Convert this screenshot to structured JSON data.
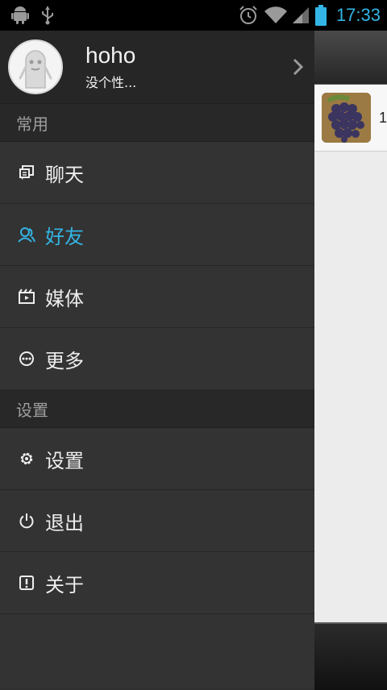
{
  "status_bar": {
    "time": "17:33",
    "icons": [
      "android-icon",
      "usb-icon",
      "alarm-icon",
      "wifi-icon",
      "signal-icon",
      "battery-icon"
    ]
  },
  "profile": {
    "username": "hoho",
    "signature": "没个性..."
  },
  "sections": {
    "common": "常用",
    "settings": "设置"
  },
  "menu": {
    "chat": "聊天",
    "friends": "好友",
    "media": "媒体",
    "more": "更多",
    "settings": "设置",
    "logout": "退出",
    "about": "关于"
  },
  "content": {
    "row_text": "1"
  },
  "colors": {
    "accent": "#33b5e5",
    "drawer_bg": "#333333",
    "header_bg": "#282828"
  }
}
